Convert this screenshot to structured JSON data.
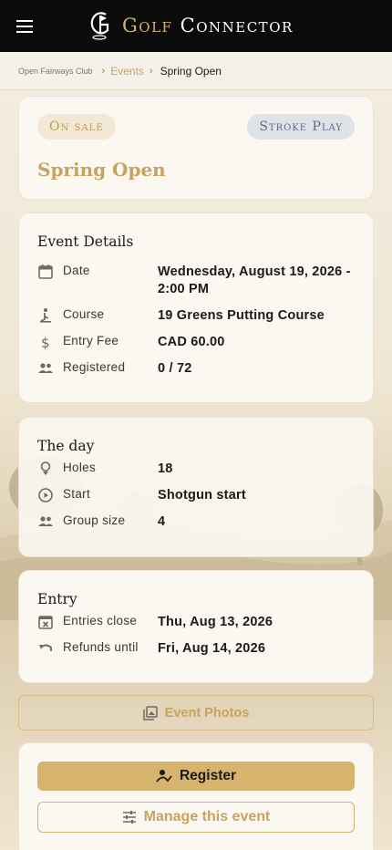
{
  "header": {
    "brand_golf": "Golf",
    "brand_connector": "Connector"
  },
  "breadcrumb": {
    "club": "Open Fairways Club",
    "events": "Events",
    "current": "Spring Open"
  },
  "event": {
    "status": "On sale",
    "format": "Stroke Play",
    "title": "Spring Open"
  },
  "details": {
    "title": "Event Details",
    "date_label": "Date",
    "date_value": "Wednesday, August 19, 2026 - 2:00 PM",
    "course_label": "Course",
    "course_value": "19 Greens Putting Course",
    "fee_label": "Entry Fee",
    "fee_value": "CAD 60.00",
    "registered_label": "Registered",
    "registered_value": "0 / 72"
  },
  "day": {
    "title": "The day",
    "holes_label": "Holes",
    "holes_value": "18",
    "start_label": "Start",
    "start_value": "Shotgun start",
    "group_label": "Group size",
    "group_value": "4"
  },
  "entry": {
    "title": "Entry",
    "close_label": "Entries close",
    "close_value": "Thu, Aug 13, 2026",
    "refund_label": "Refunds until",
    "refund_value": "Fri, Aug 14, 2026"
  },
  "actions": {
    "photos": "Event Photos",
    "register": "Register",
    "manage": "Manage this event"
  },
  "colors": {
    "accent": "#d6b46e",
    "title_gold": "#c9a260",
    "topbar": "#0b0b0b",
    "card": "#fbf8f1"
  },
  "icons": [
    "menu-icon",
    "calendar-icon",
    "golfer-icon",
    "dollar-icon",
    "group-icon",
    "golf-ball-tee-icon",
    "play-circle-icon",
    "calendar-x-icon",
    "undo-icon",
    "photo-library-icon",
    "person-check-icon",
    "sliders-icon"
  ]
}
